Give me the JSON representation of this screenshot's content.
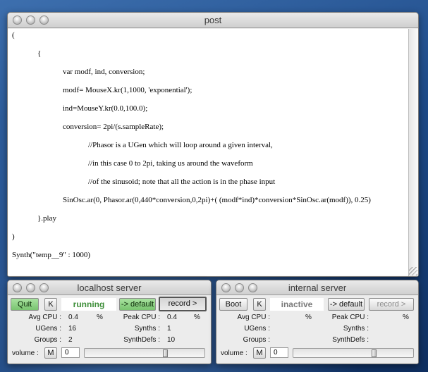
{
  "post": {
    "title": "post",
    "lines": [
      "(",
      "{",
      "var modf, ind, conversion;",
      "modf= MouseX.kr(1,1000, 'exponential');",
      "ind=MouseY.kr(0.0,100.0);",
      "conversion= 2pi/(s.sampleRate);",
      "//Phasor is a UGen which will loop around a given interval,",
      "//in this case 0 to 2pi, taking us around the waveform",
      "//of the sinusoid; note that all the action is in the phase input",
      "SinOsc.ar(0, Phasor.ar(0,440*conversion,0,2pi)+( (modf*ind)*conversion*SinOsc.ar(modf)), 0.25)",
      "}.play",
      ")",
      "Synth(\"temp__9\" : 1000)"
    ]
  },
  "localhost": {
    "title": "localhost server",
    "quit_label": "Quit",
    "kill_label": "K",
    "status": "running",
    "default_label": "-> default",
    "record_label": "record >",
    "avg_cpu_label": "Avg CPU :",
    "avg_cpu_value": "0.4",
    "pct1": "%",
    "peak_cpu_label": "Peak CPU :",
    "peak_cpu_value": "0.4",
    "pct2": "%",
    "ugens_label": "UGens :",
    "ugens_value": "16",
    "synths_label": "Synths :",
    "synths_value": "1",
    "groups_label": "Groups :",
    "groups_value": "2",
    "synthdefs_label": "SynthDefs :",
    "synthdefs_value": "10",
    "volume_label": "volume :",
    "mute_label": "M",
    "volume_value": "0",
    "volume_level": 0.96,
    "status_color": "#3f8f3a"
  },
  "internal": {
    "title": "internal server",
    "boot_label": "Boot",
    "kill_label": "K",
    "status": "inactive",
    "default_label": "-> default",
    "record_label": "record >",
    "avg_cpu_label": "Avg CPU :",
    "pct1": "%",
    "peak_cpu_label": "Peak CPU :",
    "pct2": "%",
    "ugens_label": "UGens :",
    "synths_label": "Synths :",
    "groups_label": "Groups :",
    "synthdefs_label": "SynthDefs :",
    "volume_label": "volume :",
    "mute_label": "M",
    "volume_value": "0",
    "volume_level": 0.96,
    "status_color": "#7a7a7a"
  }
}
